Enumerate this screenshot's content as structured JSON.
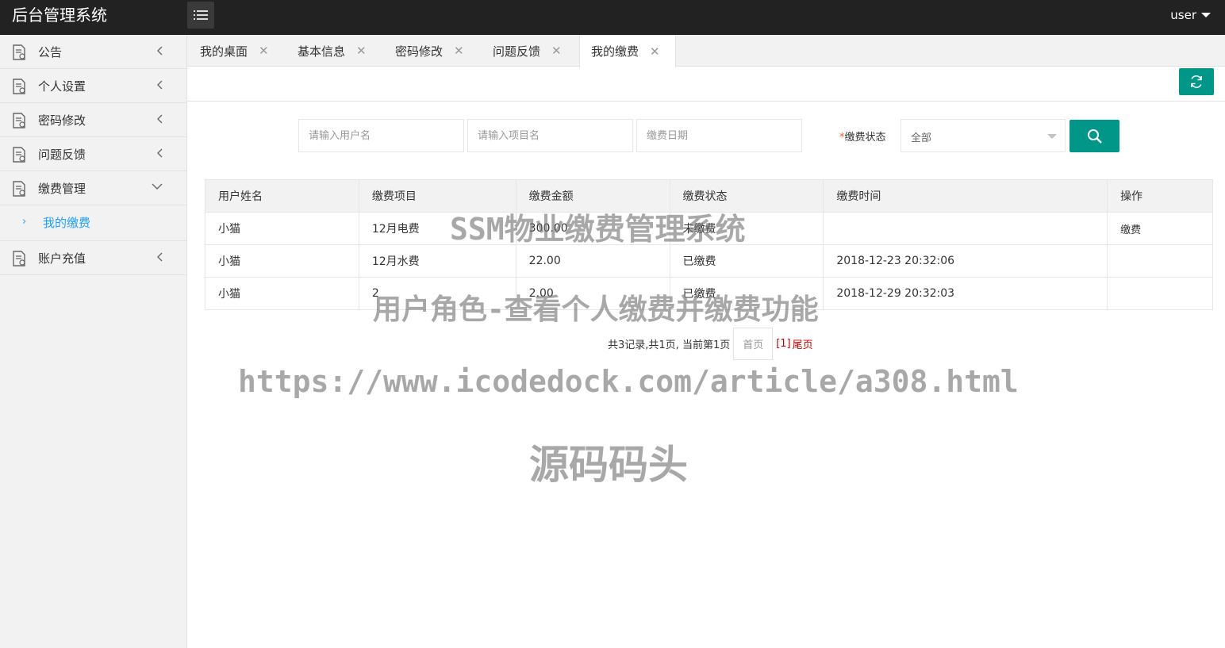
{
  "header": {
    "title": "后台管理系统",
    "user_label": "user"
  },
  "sidebar": {
    "items": [
      {
        "label": "公告"
      },
      {
        "label": "个人设置"
      },
      {
        "label": "密码修改"
      },
      {
        "label": "问题反馈"
      },
      {
        "label": "缴费管理"
      },
      {
        "label": "账户充值"
      }
    ],
    "sub_items": [
      {
        "label": "我的缴费"
      }
    ]
  },
  "tabs": [
    {
      "label": "我的桌面"
    },
    {
      "label": "基本信息"
    },
    {
      "label": "密码修改"
    },
    {
      "label": "问题反馈"
    },
    {
      "label": "我的缴费"
    }
  ],
  "search": {
    "username_placeholder": "请输入用户名",
    "item_placeholder": "请输入项目名",
    "date_placeholder": "缴费日期",
    "status_required_mark": "*",
    "status_label": "缴费状态",
    "status_value": "全部"
  },
  "table": {
    "headers": [
      "用户姓名",
      "缴费项目",
      "缴费金额",
      "缴费状态",
      "缴费时间",
      "操作"
    ],
    "rows": [
      {
        "name": "小猫",
        "item": "12月电费",
        "amount": "300.00",
        "status": "未缴费",
        "time": "",
        "action": "缴费"
      },
      {
        "name": "小猫",
        "item": "12月水费",
        "amount": "22.00",
        "status": "已缴费",
        "time": "2018-12-23 20:32:06",
        "action": ""
      },
      {
        "name": "小猫",
        "item": "2",
        "amount": "2.00",
        "status": "已缴费",
        "time": "2018-12-29 20:32:03",
        "action": ""
      }
    ]
  },
  "pager": {
    "info": "共3记录,共1页, 当前第1页",
    "first": "首页",
    "current": "[1]",
    "last": "尾页"
  },
  "watermarks": {
    "line1": "SSM物业缴费管理系统",
    "line2": "用户角色-查看个人缴费并缴费功能",
    "line3": "https://www.icodedock.com/article/a308.html",
    "line4": "源码码头"
  },
  "colors": {
    "accent": "#009688",
    "link": "#1E9FFF",
    "header_bg": "#222222"
  }
}
